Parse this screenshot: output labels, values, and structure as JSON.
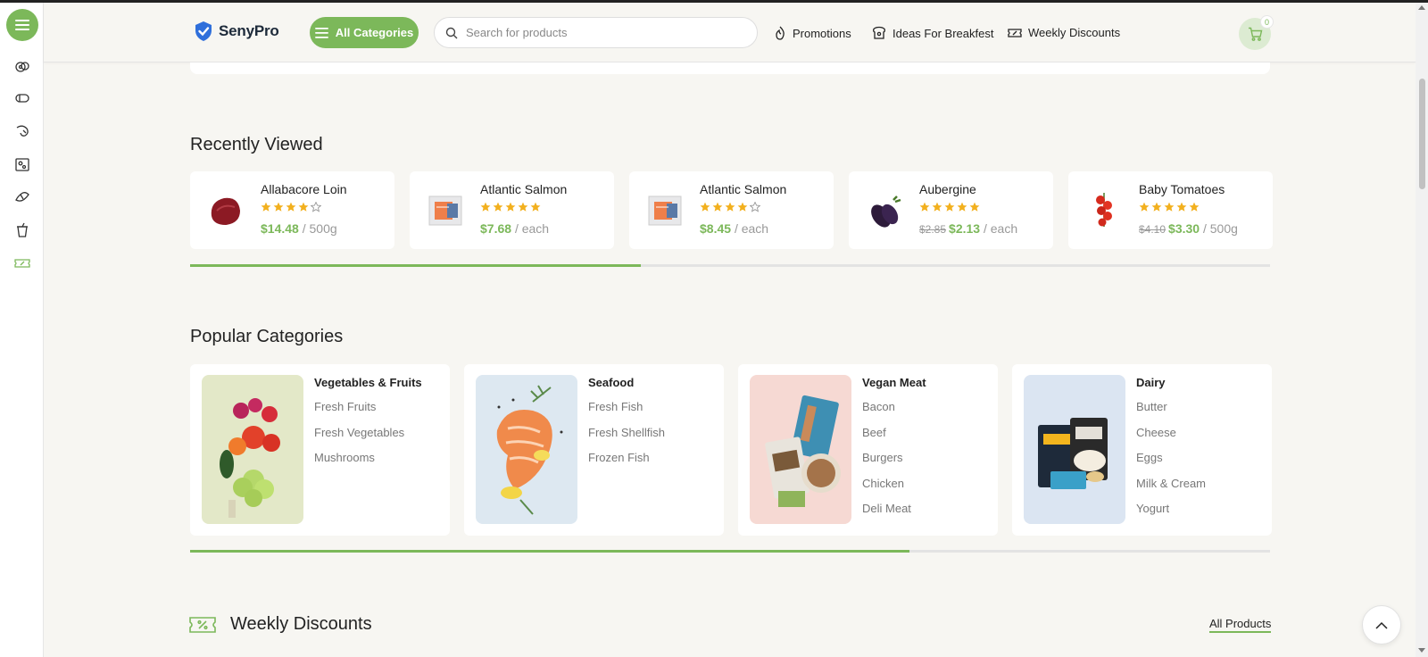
{
  "brand": {
    "name": "SenyPro",
    "accent": "#7cb85a"
  },
  "header": {
    "all_categories_label": "All Categories",
    "search_placeholder": "Search for products",
    "nav": [
      {
        "label": "Promotions",
        "icon": "flame-icon"
      },
      {
        "label": "Ideas For Breakfest",
        "icon": "toast-icon"
      },
      {
        "label": "Weekly Discounts",
        "icon": "discount-ticket-icon"
      }
    ],
    "cart_count": "0"
  },
  "sidebar": {
    "icons": [
      "avocado-icon",
      "sausage-icon",
      "shrimp-icon",
      "cheese-icon",
      "croissant-icon",
      "drink-cup-icon",
      "discount-ticket-icon"
    ]
  },
  "recently_viewed": {
    "title": "Recently Viewed",
    "progress": 0.417,
    "items": [
      {
        "name": "Allabacore Loin",
        "rating": 4,
        "old_price": "",
        "price": "$14.48",
        "unit": "/ 500g",
        "image": "tuna-loin"
      },
      {
        "name": "Atlantic Salmon",
        "rating": 5,
        "old_price": "",
        "price": "$7.68",
        "unit": "/ each",
        "image": "salmon-pack"
      },
      {
        "name": "Atlantic Salmon",
        "rating": 4,
        "old_price": "",
        "price": "$8.45",
        "unit": "/ each",
        "image": "salmon-pack"
      },
      {
        "name": "Aubergine",
        "rating": 5,
        "old_price": "$2.85",
        "price": "$2.13",
        "unit": "/ each",
        "image": "aubergine"
      },
      {
        "name": "Baby Tomatoes",
        "rating": 5,
        "old_price": "$4.10",
        "price": "$3.30",
        "unit": "/ 500g",
        "image": "cherry-tomatoes"
      }
    ]
  },
  "popular_categories": {
    "title": "Popular Categories",
    "progress": 0.666,
    "items": [
      {
        "name": "Vegetables & Fruits",
        "bg": "#e3e8c8",
        "links": [
          "Fresh Fruits",
          "Fresh Vegetables",
          "Mushrooms"
        ]
      },
      {
        "name": "Seafood",
        "bg": "#dde8f1",
        "links": [
          "Fresh Fish",
          "Fresh Shellfish",
          "Frozen Fish"
        ]
      },
      {
        "name": "Vegan Meat",
        "bg": "#f6d9d3",
        "links": [
          "Bacon",
          "Beef",
          "Burgers",
          "Chicken",
          "Deli Meat"
        ]
      },
      {
        "name": "Dairy",
        "bg": "#dbe5f2",
        "links": [
          "Butter",
          "Cheese",
          "Eggs",
          "Milk & Cream",
          "Yogurt"
        ]
      }
    ]
  },
  "weekly_discounts": {
    "title": "Weekly Discounts",
    "all_products_label": "All Products"
  }
}
